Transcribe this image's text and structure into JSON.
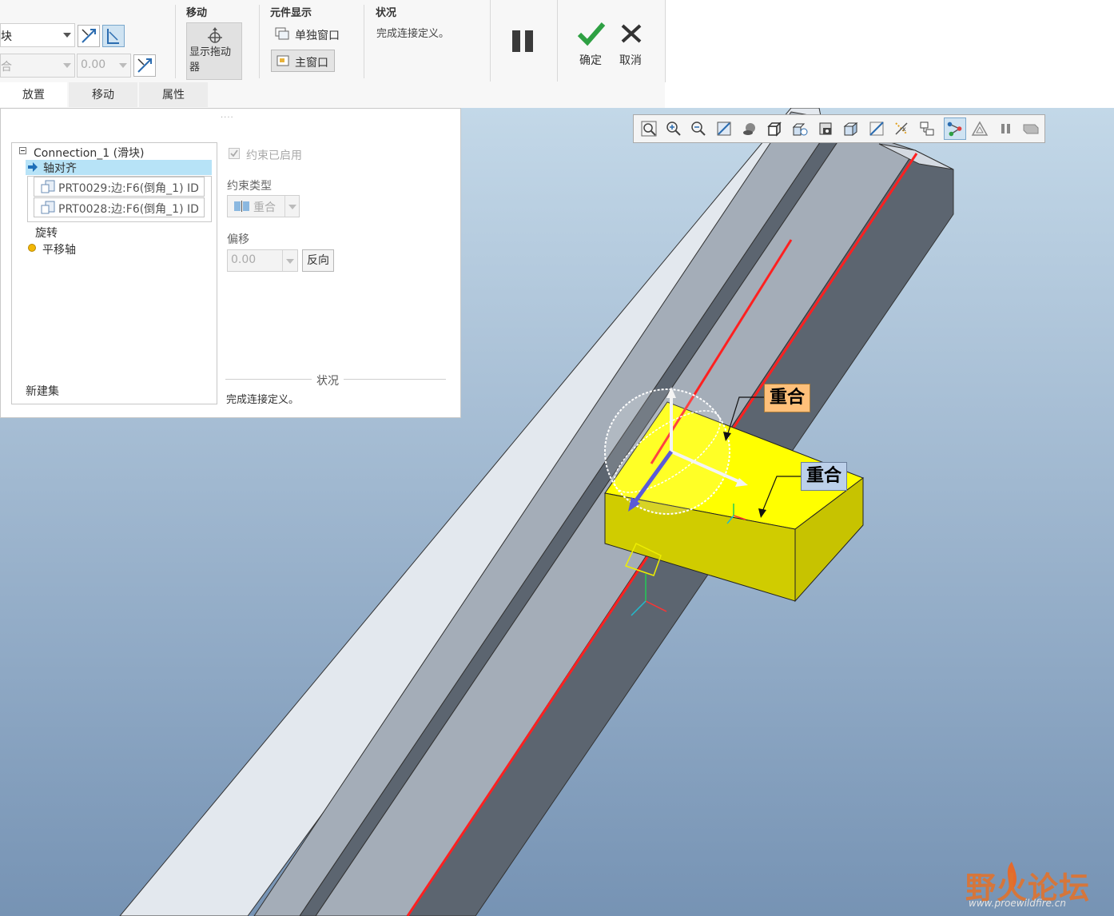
{
  "ribbon": {
    "row1_combo_text": "块",
    "row2_combo_text": "合",
    "row2_offset_value": "0.00",
    "groups": {
      "move_title": "移动",
      "component_display_title": "元件显示",
      "status_title": "状况"
    },
    "show_drag_label": "显示拖动器",
    "separate_window_label": "单独窗口",
    "main_window_label": "主窗口",
    "status_text": "完成连接定义。",
    "ok_label": "确定",
    "cancel_label": "取消"
  },
  "tabs": [
    {
      "label": "放置",
      "active": true
    },
    {
      "label": "移动",
      "active": false
    },
    {
      "label": "属性",
      "active": false
    }
  ],
  "panel": {
    "tree": {
      "connection": "Connection_1 (滑块)",
      "axis_align": "轴对齐",
      "refs": [
        "PRT0029:边:F6(倒角_1) ID",
        "PRT0028:边:F6(倒角_1) ID"
      ],
      "rotation": "旋转",
      "translation_axis": "平移轴",
      "new_set": "新建集"
    },
    "constraint_enabled_label": "约束已启用",
    "constraint_type_label": "约束类型",
    "constraint_type_value": "重合",
    "offset_label": "偏移",
    "offset_value": "0.00",
    "flip_button": "反向",
    "status_heading": "状况",
    "status_text": "完成连接定义。"
  },
  "viewport": {
    "callout_1": "重合",
    "callout_2": "重合",
    "watermark": "野火论坛",
    "watermark_url": "www.proewildfire.cn"
  },
  "view_toolbar_icons": [
    "refit-icon",
    "zoom-in-icon",
    "zoom-out-icon",
    "repaint-icon",
    "display-style-icon",
    "saved-views-icon",
    "view-manager-icon",
    "perspective-icon",
    "section-icon",
    "datum-display-icon",
    "annotation-display-icon",
    "spin-center-icon",
    "mechanism-display-icon",
    "snapshot-icon",
    "pause-icon",
    "animation-icon"
  ],
  "colors": {
    "accent_selected": "#b7e3f7",
    "confirm_green": "#2ea043",
    "callout_orange": "#ffc07a",
    "callout_blue": "#bcd0ea",
    "model_yellow": "#ffff00",
    "axis_red": "#ff2020"
  }
}
